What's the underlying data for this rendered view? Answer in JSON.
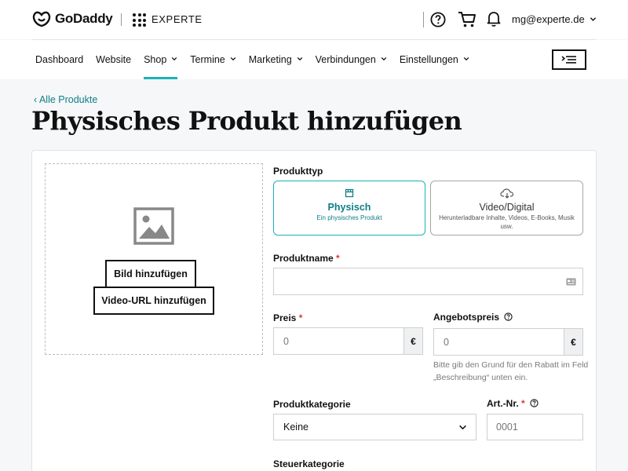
{
  "header": {
    "logo_text": "GoDaddy",
    "product_name": "EXPERTE",
    "account_email": "mg@experte.de"
  },
  "nav": {
    "items": [
      {
        "label": "Dashboard",
        "has_chevron": false
      },
      {
        "label": "Website",
        "has_chevron": false
      },
      {
        "label": "Shop",
        "has_chevron": true,
        "active": true
      },
      {
        "label": "Termine",
        "has_chevron": true
      },
      {
        "label": "Marketing",
        "has_chevron": true
      },
      {
        "label": "Verbindungen",
        "has_chevron": true
      },
      {
        "label": "Einstellungen",
        "has_chevron": true
      }
    ]
  },
  "page": {
    "back_link": "Alle Produkte",
    "title": "Physisches Produkt hinzufügen"
  },
  "media": {
    "add_image_label": "Bild hinzufügen",
    "add_video_label": "Video-URL hinzufügen"
  },
  "form": {
    "product_type_label": "Produkttyp",
    "type_physical": {
      "title": "Physisch",
      "subtitle": "Ein physisches Produkt"
    },
    "type_digital": {
      "title": "Video/Digital",
      "subtitle": "Herunterladbare Inhalte, Videos, E-Books, Musik usw."
    },
    "product_name_label": "Produktname",
    "price_label": "Preis",
    "price_value": "0",
    "sale_price_label": "Angebotspreis",
    "sale_price_value": "0",
    "currency": "€",
    "sale_hint": "Bitte gib den Grund für den Rabatt im Feld „Beschreibung“ unten ein.",
    "category_label": "Produktkategorie",
    "category_value": "Keine",
    "sku_label": "Art.-Nr.",
    "sku_placeholder": "0001",
    "tax_label": "Steuerkategorie",
    "required_marker": "*"
  },
  "colors": {
    "accent": "#1bb1b6",
    "link": "#0e7f88",
    "required": "#d43c3c"
  }
}
